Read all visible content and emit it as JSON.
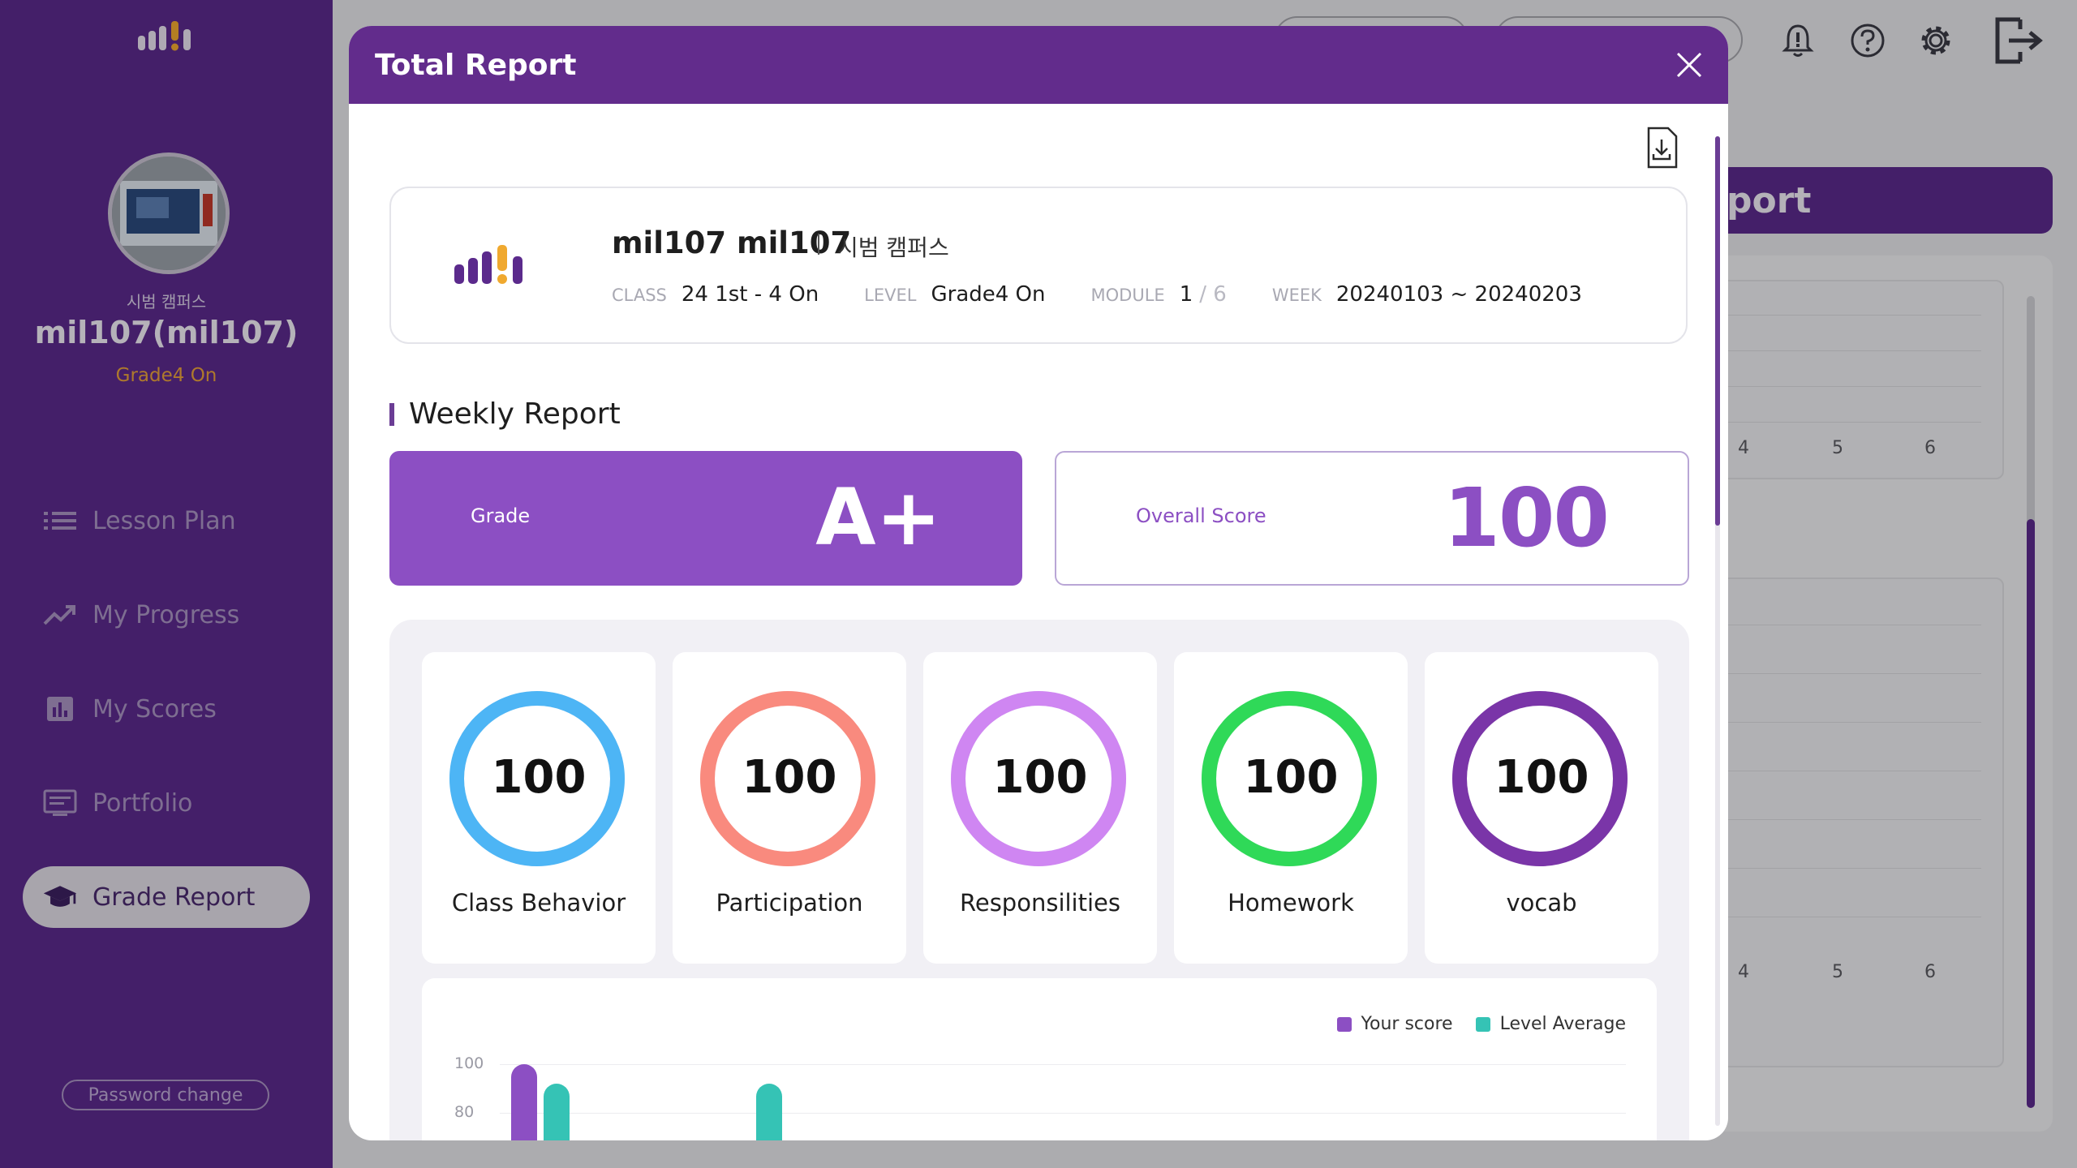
{
  "sidebar": {
    "campus": "시범 캠퍼스",
    "username": "mil107(mil107)",
    "level": "Grade4 On",
    "items": [
      {
        "label": "Lesson Plan",
        "icon": "list-icon"
      },
      {
        "label": "My Progress",
        "icon": "trend-icon"
      },
      {
        "label": "My Scores",
        "icon": "bar-chart-icon"
      },
      {
        "label": "Portfolio",
        "icon": "portfolio-icon"
      },
      {
        "label": "Grade Report",
        "icon": "graduation-cap-icon"
      }
    ],
    "active_item": "Grade Report",
    "password_change": "Password change"
  },
  "background": {
    "banner_text": "port",
    "axis_numbers_top": [
      "4",
      "5",
      "6"
    ],
    "axis_numbers_bottom": [
      "4",
      "5",
      "6"
    ],
    "top_icons": [
      "bell-icon",
      "help-icon",
      "gear-icon",
      "logout-icon"
    ]
  },
  "modal": {
    "title": "Total Report",
    "student": {
      "name": "mil107 mil107",
      "campus": "시범 캠퍼스",
      "class_label": "CLASS",
      "class_value": "24 1st - 4 On",
      "level_label": "LEVEL",
      "level_value": "Grade4 On",
      "module_label": "MODULE",
      "module_current": "1",
      "module_total": "/ 6",
      "week_label": "WEEK",
      "week_value": "20240103 ~ 20240203"
    },
    "weekly": {
      "section_title": "Weekly Report",
      "grade_label": "Grade",
      "grade_value": "A+",
      "score_label": "Overall Score",
      "score_value": "100"
    },
    "metrics": [
      {
        "label": "Class Behavior",
        "value": "100",
        "percent": 100,
        "color": "#4db5f5"
      },
      {
        "label": "Participation",
        "value": "100",
        "percent": 100,
        "color": "#f98a7e"
      },
      {
        "label": "Responsilities",
        "value": "100",
        "percent": 100,
        "color": "#cf86f2"
      },
      {
        "label": "Homework",
        "value": "100",
        "percent": 100,
        "color": "#2fd958"
      },
      {
        "label": "vocab",
        "value": "100",
        "percent": 100,
        "color": "#7a35a8"
      }
    ]
  },
  "chart_data": {
    "type": "bar",
    "legend": [
      "Your score",
      "Level Average"
    ],
    "y_ticks": [
      "100",
      "80"
    ],
    "series": [
      {
        "name": "Your score",
        "color": "#8c4fc3",
        "values": [
          100
        ]
      },
      {
        "name": "Level Average",
        "color": "#35c3b5",
        "values": [
          92,
          92
        ]
      }
    ],
    "legend_position": "top-right",
    "grid": true
  }
}
